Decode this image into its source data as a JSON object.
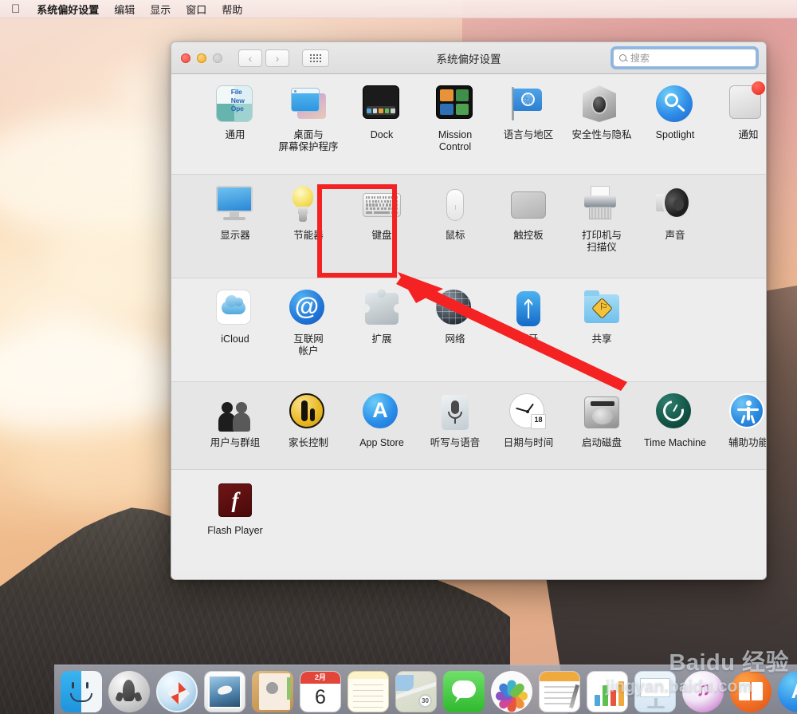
{
  "menubar": {
    "apple_icon": "apple-logo-icon",
    "items": [
      {
        "label": "系统偏好设置",
        "bold": true
      },
      {
        "label": "编辑",
        "bold": false
      },
      {
        "label": "显示",
        "bold": false
      },
      {
        "label": "窗口",
        "bold": false
      },
      {
        "label": "帮助",
        "bold": false
      }
    ]
  },
  "window": {
    "title": "系统偏好设置",
    "traffic_lights": {
      "close": "close-button",
      "minimize": "minimize-button",
      "zoom": "zoom-button"
    },
    "nav": {
      "back": "‹",
      "forward": "›"
    },
    "grid_button": "show-all-button",
    "search": {
      "placeholder": "搜索",
      "value": "",
      "icon": "search-icon"
    }
  },
  "rows": [
    {
      "id": "row-personal",
      "panes": [
        {
          "name": "general",
          "label": "通用",
          "icon": "general-icon",
          "icon_text": "File\nNew\nOpe"
        },
        {
          "name": "desktop-screensaver",
          "label": "桌面与\n屏幕保护程序",
          "icon": "desktop-icon"
        },
        {
          "name": "dock",
          "label": "Dock",
          "icon": "dock-icon"
        },
        {
          "name": "mission-control",
          "label": "Mission\nControl",
          "icon": "mission-control-icon"
        },
        {
          "name": "language-region",
          "label": "语言与地区",
          "icon": "flag-icon"
        },
        {
          "name": "security-privacy",
          "label": "安全性与隐私",
          "icon": "security-house-icon"
        },
        {
          "name": "spotlight",
          "label": "Spotlight",
          "icon": "spotlight-icon"
        },
        {
          "name": "notifications",
          "label": "通知",
          "icon": "notification-icon"
        }
      ]
    },
    {
      "id": "row-hardware",
      "panes": [
        {
          "name": "displays",
          "label": "显示器",
          "icon": "display-icon"
        },
        {
          "name": "energy-saver",
          "label": "节能器",
          "icon": "lightbulb-icon"
        },
        {
          "name": "keyboard",
          "label": "键盘",
          "icon": "keyboard-icon",
          "highlighted": true
        },
        {
          "name": "mouse",
          "label": "鼠标",
          "icon": "mouse-icon"
        },
        {
          "name": "trackpad",
          "label": "触控板",
          "icon": "trackpad-icon"
        },
        {
          "name": "printers-scanners",
          "label": "打印机与\n扫描仪",
          "icon": "printer-icon"
        },
        {
          "name": "sound",
          "label": "声音",
          "icon": "speaker-icon"
        }
      ]
    },
    {
      "id": "row-internet",
      "panes": [
        {
          "name": "icloud",
          "label": "iCloud",
          "icon": "icloud-icon"
        },
        {
          "name": "internet-accounts",
          "label": "互联网\n帐户",
          "icon": "at-sign-icon"
        },
        {
          "name": "extensions",
          "label": "扩展",
          "icon": "puzzle-icon"
        },
        {
          "name": "network",
          "label": "网络",
          "icon": "globe-icon"
        },
        {
          "name": "bluetooth",
          "label": "蓝牙",
          "icon": "bluetooth-icon"
        },
        {
          "name": "sharing",
          "label": "共享",
          "icon": "sharing-folder-icon"
        }
      ]
    },
    {
      "id": "row-system",
      "panes": [
        {
          "name": "users-groups",
          "label": "用户与群组",
          "icon": "users-icon"
        },
        {
          "name": "parental-controls",
          "label": "家长控制",
          "icon": "parental-icon"
        },
        {
          "name": "app-store",
          "label": "App Store",
          "icon": "appstore-icon"
        },
        {
          "name": "dictation-speech",
          "label": "听写与语音",
          "icon": "microphone-icon"
        },
        {
          "name": "date-time",
          "label": "日期与时间",
          "icon": "clock-icon",
          "cal_day": "18"
        },
        {
          "name": "startup-disk",
          "label": "启动磁盘",
          "icon": "harddisk-icon"
        },
        {
          "name": "time-machine",
          "label": "Time Machine",
          "icon": "timemachine-icon"
        },
        {
          "name": "accessibility",
          "label": "辅助功能",
          "icon": "accessibility-icon"
        }
      ]
    },
    {
      "id": "row-other",
      "panes": [
        {
          "name": "flash-player",
          "label": "Flash Player",
          "icon": "flash-icon",
          "icon_glyph": "f"
        }
      ]
    }
  ],
  "annotation": {
    "highlight_target": "键盘",
    "color": "#f42222",
    "shape": "rectangle-with-arrow"
  },
  "dock": {
    "apps": [
      {
        "name": "finder",
        "label": "Finder",
        "running": true
      },
      {
        "name": "launchpad",
        "label": "Launchpad",
        "running": false
      },
      {
        "name": "safari",
        "label": "Safari",
        "running": true
      },
      {
        "name": "mail",
        "label": "Mail",
        "running": false
      },
      {
        "name": "contacts",
        "label": "Contacts",
        "running": false
      },
      {
        "name": "calendar",
        "label": "Calendar",
        "month": "2月",
        "day": "6"
      },
      {
        "name": "notes",
        "label": "Notes",
        "running": false
      },
      {
        "name": "maps",
        "label": "Maps",
        "pin": "30"
      },
      {
        "name": "messages",
        "label": "Messages",
        "running": false
      },
      {
        "name": "photos",
        "label": "Photos",
        "running": false
      },
      {
        "name": "pages",
        "label": "Pages",
        "running": false
      },
      {
        "name": "numbers",
        "label": "Numbers",
        "running": false
      },
      {
        "name": "keynote",
        "label": "Keynote",
        "running": false
      },
      {
        "name": "itunes",
        "label": "iTunes",
        "running": false
      },
      {
        "name": "ibooks",
        "label": "iBooks",
        "running": false
      },
      {
        "name": "appstore",
        "label": "App Store",
        "running": false
      }
    ]
  },
  "watermark": {
    "line1": "Baidu 经验",
    "line2": "jingyan.baidu.com"
  }
}
